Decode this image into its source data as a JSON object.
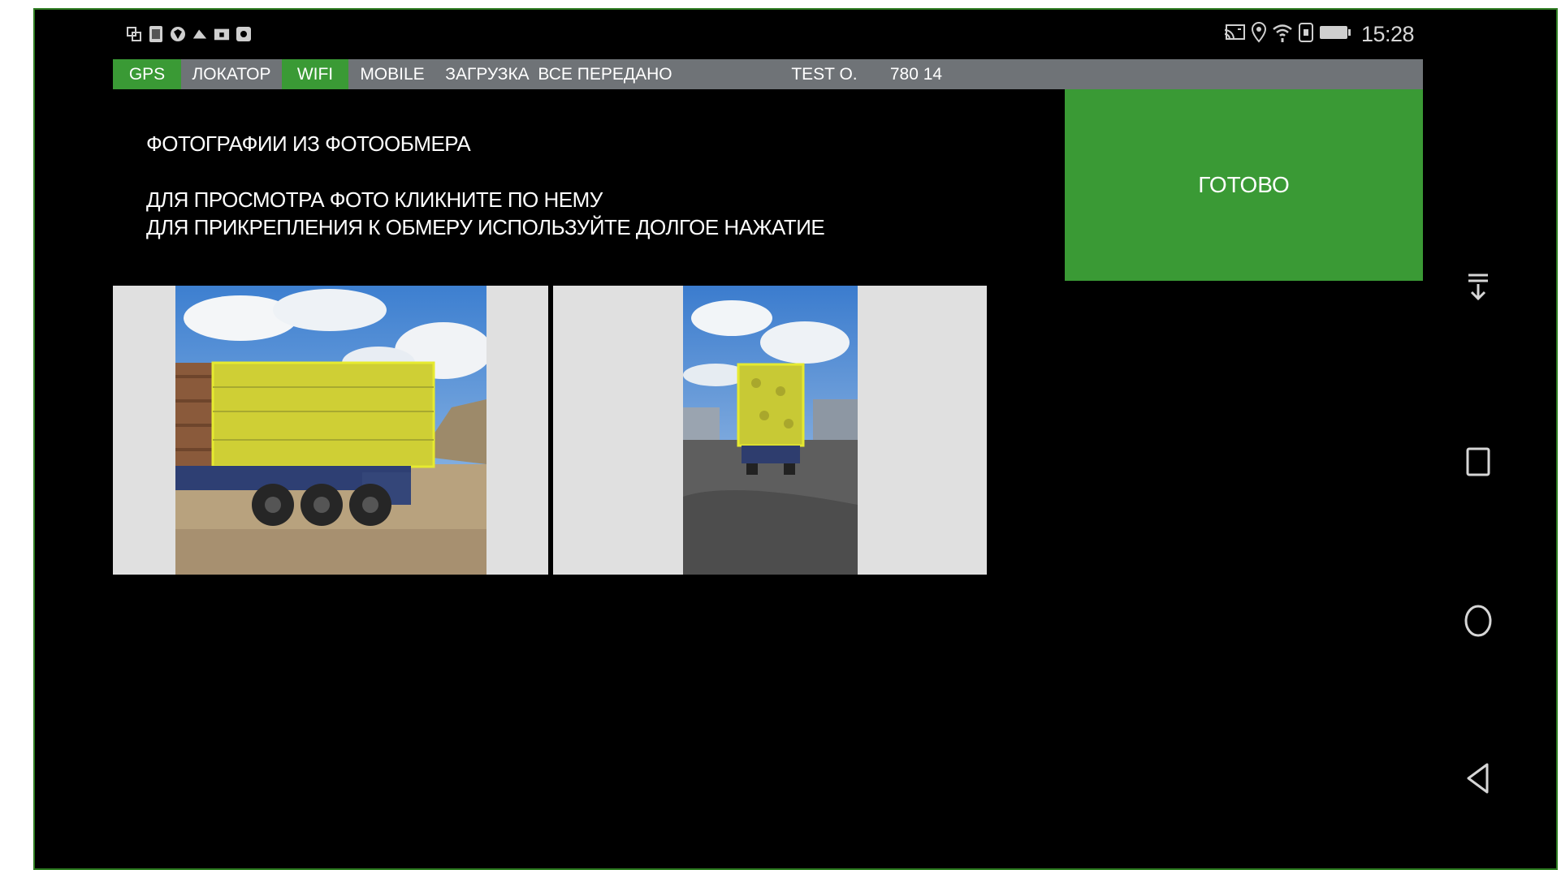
{
  "status_bar": {
    "left_icons": [
      "notification-icon",
      "sim-icon",
      "shield-icon",
      "cloud-icon",
      "folder-icon",
      "app-icon"
    ],
    "right_icons": [
      "cast-icon",
      "location-icon",
      "wifi-icon",
      "nfc-icon",
      "battery-icon"
    ],
    "time": "15:28"
  },
  "tabs": [
    {
      "label": "GPS",
      "active": true
    },
    {
      "label": "ЛОКАТОР",
      "active": false
    },
    {
      "label": "WIFI",
      "active": true
    },
    {
      "label": "MOBILE",
      "active": false
    },
    {
      "label": "ЗАГРУЗКА",
      "active": false
    },
    {
      "label": "ВСЕ ПЕРЕДАНО",
      "active": false
    },
    {
      "label": "",
      "active": false
    },
    {
      "label": "TEST O.",
      "active": false
    },
    {
      "label": "780 14",
      "active": false
    }
  ],
  "page": {
    "title": "ФОТОГРАФИИ ИЗ ФОТООБМЕРА",
    "hint_view": "ДЛЯ ПРОСМОТРА ФОТО КЛИКНИТЕ ПО НЕМУ",
    "hint_attach": "ДЛЯ ПРИКРЕПЛЕНИЯ К ОБМЕРУ ИСПОЛЬЗУЙТЕ ДОЛГОЕ НАЖАТИЕ"
  },
  "done_button": {
    "label": "ГОТОВО"
  },
  "photos": [
    {
      "subject": "truck-side-view-timber-load"
    },
    {
      "subject": "truck-rear-view-timber-load"
    }
  ],
  "nav_bar": {
    "icons": [
      "pull-down-icon",
      "recents-icon",
      "home-icon",
      "back-icon"
    ]
  },
  "colors": {
    "accent_green": "#3a9a35",
    "tab_bar_gray": "#6f7377",
    "background": "#000000",
    "photo_frame": "#e0e0e0",
    "overlay_yellow": "#d8dc2a"
  }
}
